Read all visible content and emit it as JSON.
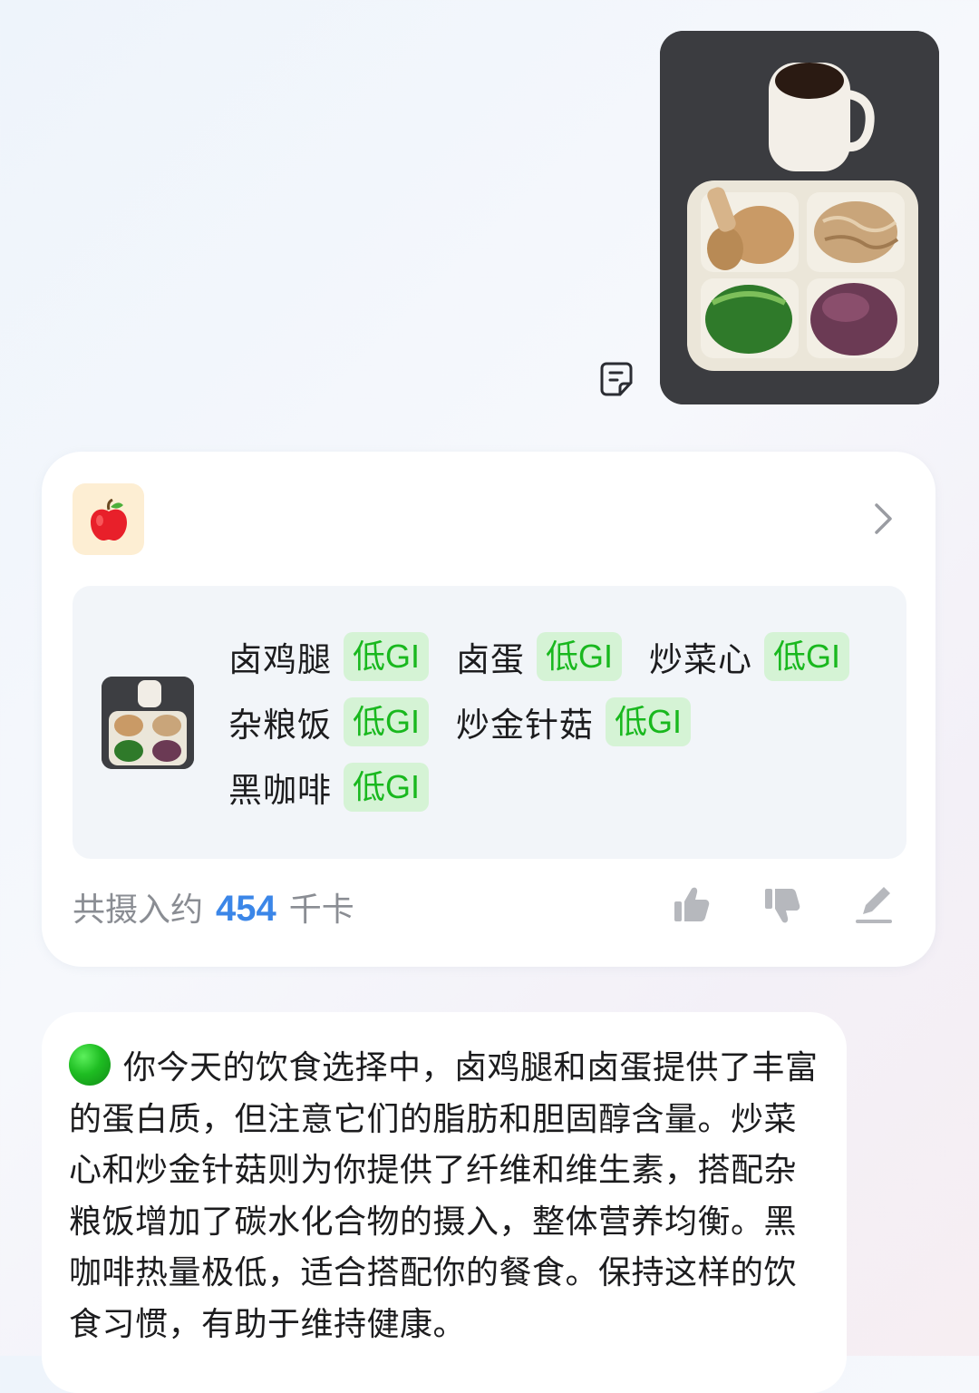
{
  "sent_message": {
    "photo_icon": "meal-tray-photo",
    "note_icon": "note-icon"
  },
  "analysis_card": {
    "app_icon": "apple-icon",
    "chevron_icon": "chevron-right-icon",
    "foods_row1": [
      {
        "name": "卤鸡腿",
        "gi": "低GI"
      },
      {
        "name": "卤蛋",
        "gi": "低GI"
      },
      {
        "name": "炒菜心",
        "gi": "低GI"
      }
    ],
    "foods_row2": [
      {
        "name": "杂粮饭",
        "gi": "低GI"
      },
      {
        "name": "炒金针菇",
        "gi": "低GI"
      }
    ],
    "foods_row3": [
      {
        "name": "黑咖啡",
        "gi": "低GI"
      }
    ],
    "calorie_prefix": "共摄入约",
    "calorie_value": "454",
    "calorie_unit": "千卡",
    "actions": [
      "thumbs-up-icon",
      "thumbs-down-icon",
      "edit-icon"
    ]
  },
  "reply": {
    "indicator_icon": "green-circle-icon",
    "text": "你今天的饮食选择中，卤鸡腿和卤蛋提供了丰富的蛋白质，但注意它们的脂肪和胆固醇含量。炒菜心和炒金针菇则为你提供了纤维和维生素，搭配杂粮饭增加了碳水化合物的摄入，整体营养均衡。黑咖啡热量极低，适合搭配你的餐食。保持这样的饮食习惯，有助于维持健康。"
  },
  "colors": {
    "gi_badge_bg": "#d5f3d5",
    "gi_badge_text": "#19b81e",
    "calorie_accent": "#3b86e8",
    "apple_tile_bg": "#fdeed3"
  }
}
